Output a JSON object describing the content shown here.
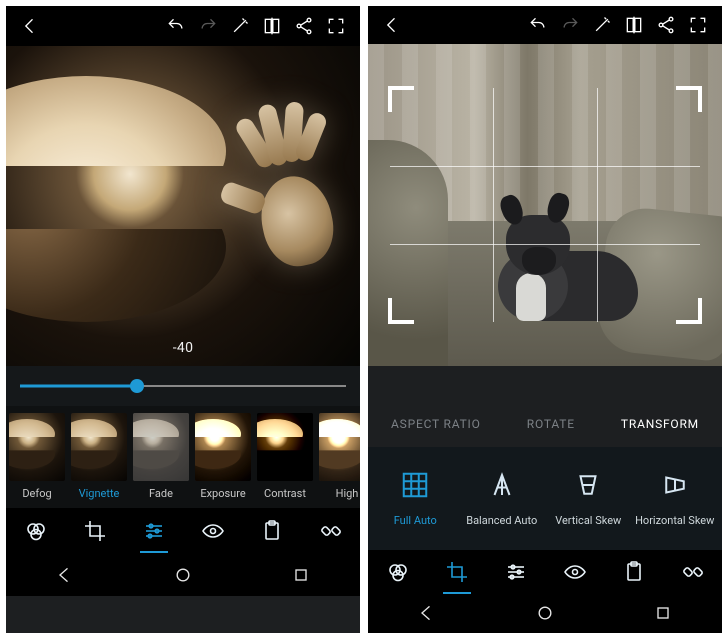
{
  "accent_color": "#1e9ad6",
  "left": {
    "value_readout": "-40",
    "slider_fraction": 0.36,
    "filters": [
      {
        "key": "defog",
        "label": "Defog",
        "active": false
      },
      {
        "key": "vignette",
        "label": "Vignette",
        "active": true
      },
      {
        "key": "fade",
        "label": "Fade",
        "active": false
      },
      {
        "key": "exposure",
        "label": "Exposure",
        "active": false
      },
      {
        "key": "contrast",
        "label": "Contrast",
        "active": false
      },
      {
        "key": "high",
        "label": "High",
        "active": false
      }
    ],
    "active_tool_index": 2
  },
  "right": {
    "subtabs": [
      {
        "label": "ASPECT RATIO",
        "active": false
      },
      {
        "label": "ROTATE",
        "active": false
      },
      {
        "label": "TRANSFORM",
        "active": true
      }
    ],
    "options": [
      {
        "key": "full_auto",
        "label": "Full Auto",
        "active": true
      },
      {
        "key": "balanced_auto",
        "label": "Balanced Auto",
        "active": false
      },
      {
        "key": "vertical_skew",
        "label": "Vertical Skew",
        "active": false
      },
      {
        "key": "horizontal_skew",
        "label": "Horizontal Skew",
        "active": false
      }
    ],
    "active_tool_index": 1
  },
  "tool_names": [
    "looks",
    "crop",
    "adjust",
    "eye",
    "clipboard",
    "heal"
  ]
}
